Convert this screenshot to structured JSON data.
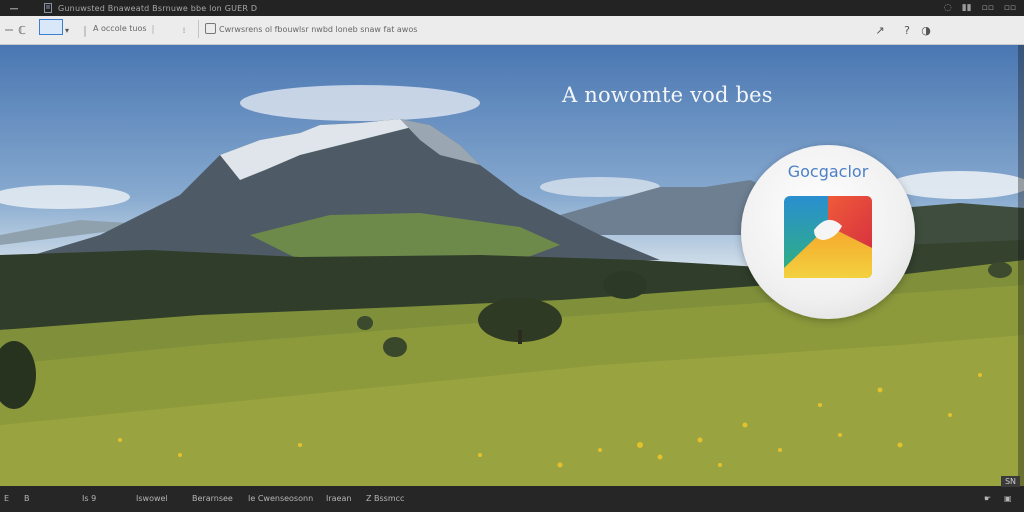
{
  "titlebar": {
    "title": "Gunuwsted  Bnaweatd  Bsrnuwe  bbe  lon  GUER  D",
    "icons": [
      "minimize-icon",
      "document-icon"
    ],
    "right_glyphs": [
      "◌",
      "▮▮",
      "▫▫",
      "▫▫"
    ]
  },
  "toolbar": {
    "back_label": "ℂ",
    "nav_text": "A  occole  tuos",
    "address_text": "Cwrwsrens  ol  fbouwlsr  nwbd  loneb  snaw  fat  awos",
    "right_glyphs": [
      "↗",
      "?",
      "◑"
    ]
  },
  "content": {
    "headline": "A nowomte vod bes",
    "app_name": "Gocgaclor"
  },
  "statusbar": {
    "items": [
      "E",
      "B",
      "Is 9",
      "Iswowel",
      "Berarnsee",
      "Ie  Cwenseosonn",
      "Iraean",
      "Z  Bssmcc"
    ],
    "right_badge": "SN",
    "right_icons": [
      "☛",
      "▣"
    ]
  },
  "colors": {
    "accent": "#3c7fd0",
    "app_name": "#4d80c9"
  }
}
